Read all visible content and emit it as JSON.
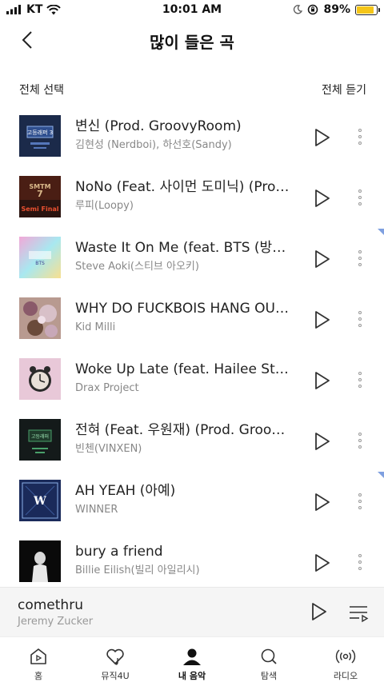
{
  "status": {
    "carrier": "KT",
    "time": "10:01 AM",
    "battery": "89%",
    "battery_level": 0.89
  },
  "header": {
    "title": "많이 들은 곡"
  },
  "controls": {
    "select_all": "전체 선택",
    "play_all": "전체 듣기"
  },
  "tracks": [
    {
      "title": "변신 (Prod. GroovyRoom)",
      "artist": "김현성 (Nerdboi), 하선호(Sandy)",
      "art_label": "고등래퍼 3"
    },
    {
      "title": "NoNo (Feat. 사이먼 도미닉) (Prod…",
      "artist": "루피(Loopy)",
      "art_label": "Semi Final"
    },
    {
      "title": "Waste It On Me (feat. BTS (방탄…",
      "artist": "Steve Aoki(스티브 아오키)",
      "art_label": ""
    },
    {
      "title": "WHY DO FUCKBOIS HANG OU…",
      "artist": "Kid Milli",
      "art_label": ""
    },
    {
      "title": "Woke Up Late (feat. Hailee Stein…",
      "artist": "Drax Project",
      "art_label": ""
    },
    {
      "title": "전혀 (Feat. 우원재) (Prod. Groov…",
      "artist": "빈첸(VINXEN)",
      "art_label": "고등래퍼"
    },
    {
      "title": "AH YEAH (아예)",
      "artist": "WINNER",
      "art_label": "W"
    },
    {
      "title": "bury a friend",
      "artist": "Billie Eilish(빌리 아일리시)",
      "art_label": ""
    }
  ],
  "now_playing": {
    "title": "comethru",
    "artist": "Jeremy Zucker"
  },
  "tabs": [
    {
      "label": "홈",
      "icon": "home-icon"
    },
    {
      "label": "뮤직4U",
      "icon": "heart-music-icon"
    },
    {
      "label": "내 음악",
      "icon": "person-icon"
    },
    {
      "label": "탐색",
      "icon": "search-icon"
    },
    {
      "label": "라디오",
      "icon": "radio-icon"
    }
  ],
  "colors": {
    "battery": "#f5c518",
    "flag": "#7fa0e0"
  }
}
